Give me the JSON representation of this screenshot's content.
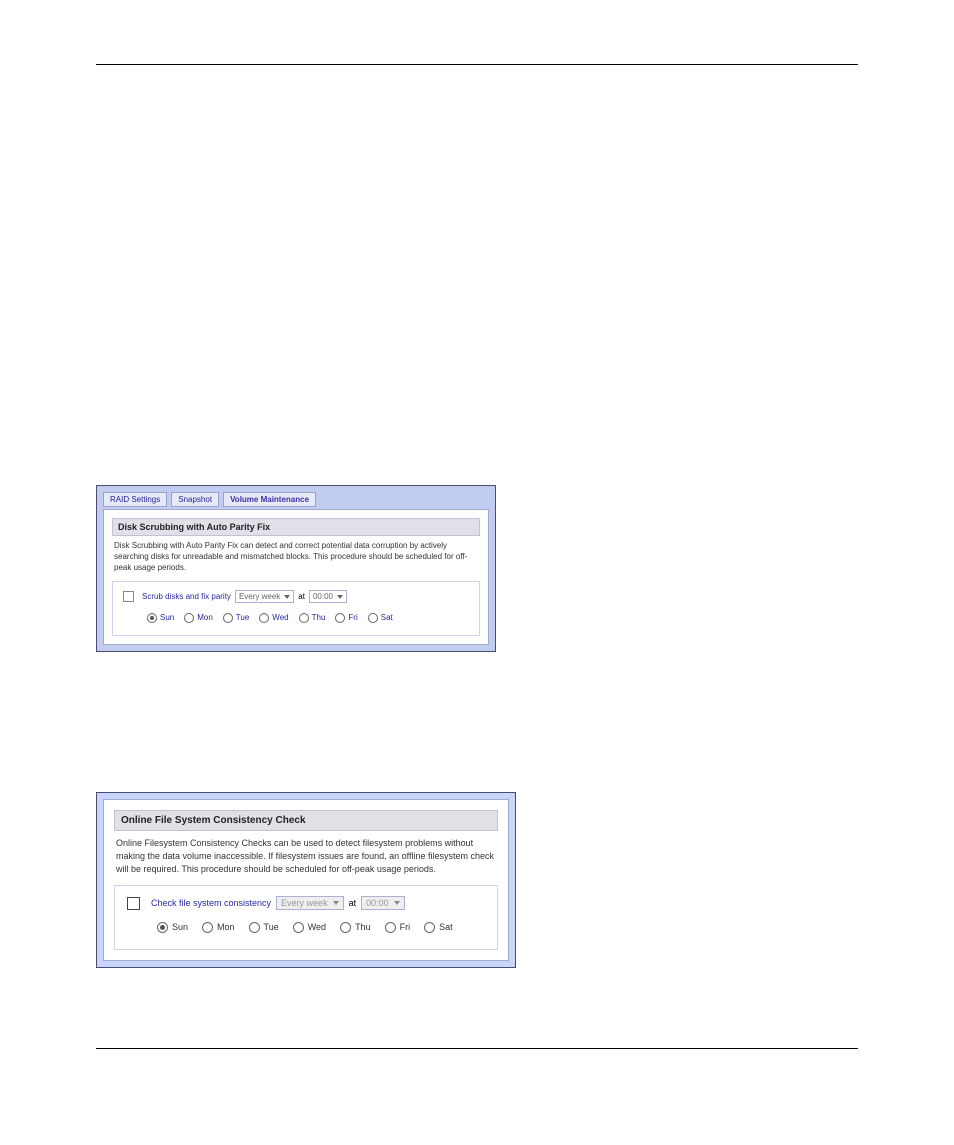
{
  "screenshot1": {
    "tabs": [
      "RAID Settings",
      "Snapshot",
      "Volume Maintenance"
    ],
    "active_tab_index": 2,
    "heading": "Disk Scrubbing with Auto Parity Fix",
    "description": "Disk Scrubbing with Auto Parity Fix can detect and correct potential data corruption by actively searching disks for unreadable and mismatched blocks. This procedure should be scheduled for off-peak usage periods.",
    "checkbox_label": "Scrub disks and fix parity",
    "checkbox_checked": false,
    "frequency_value": "Every week",
    "at_label": "at",
    "time_value": "00:00",
    "days": [
      "Sun",
      "Mon",
      "Tue",
      "Wed",
      "Thu",
      "Fri",
      "Sat"
    ],
    "selected_day_index": 0
  },
  "screenshot2": {
    "heading": "Online File System Consistency Check",
    "description": "Online Filesystem Consistency Checks can be used to detect filesystem problems without making the data volume inaccessible. If filesystem issues are found, an offline filesystem check will be required. This procedure should be scheduled for off-peak usage periods.",
    "checkbox_label": "Check file system consistency",
    "checkbox_checked": false,
    "frequency_value": "Every week",
    "at_label": "at",
    "time_value": "00:00",
    "days": [
      "Sun",
      "Mon",
      "Tue",
      "Wed",
      "Thu",
      "Fri",
      "Sat"
    ],
    "selected_day_index": 0
  }
}
